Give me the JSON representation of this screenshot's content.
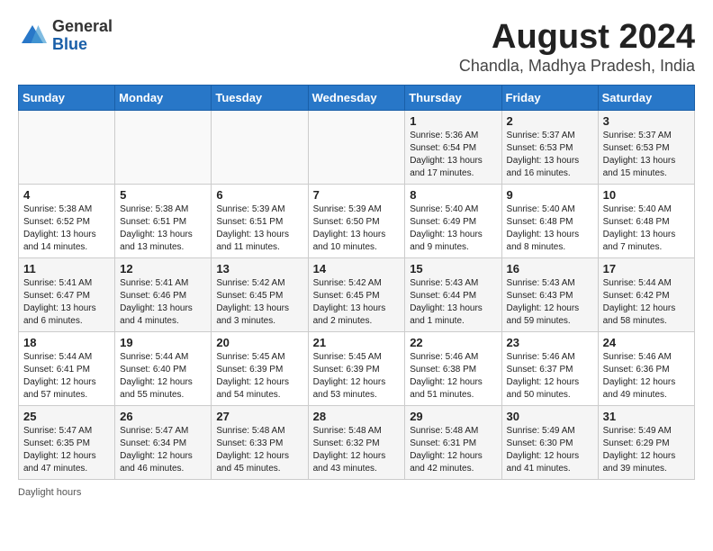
{
  "logo": {
    "line1": "General",
    "line2": "Blue"
  },
  "title": "August 2024",
  "subtitle": "Chandla, Madhya Pradesh, India",
  "days_of_week": [
    "Sunday",
    "Monday",
    "Tuesday",
    "Wednesday",
    "Thursday",
    "Friday",
    "Saturday"
  ],
  "weeks": [
    [
      {
        "day": "",
        "info": ""
      },
      {
        "day": "",
        "info": ""
      },
      {
        "day": "",
        "info": ""
      },
      {
        "day": "",
        "info": ""
      },
      {
        "day": "1",
        "info": "Sunrise: 5:36 AM\nSunset: 6:54 PM\nDaylight: 13 hours and 17 minutes."
      },
      {
        "day": "2",
        "info": "Sunrise: 5:37 AM\nSunset: 6:53 PM\nDaylight: 13 hours and 16 minutes."
      },
      {
        "day": "3",
        "info": "Sunrise: 5:37 AM\nSunset: 6:53 PM\nDaylight: 13 hours and 15 minutes."
      }
    ],
    [
      {
        "day": "4",
        "info": "Sunrise: 5:38 AM\nSunset: 6:52 PM\nDaylight: 13 hours and 14 minutes."
      },
      {
        "day": "5",
        "info": "Sunrise: 5:38 AM\nSunset: 6:51 PM\nDaylight: 13 hours and 13 minutes."
      },
      {
        "day": "6",
        "info": "Sunrise: 5:39 AM\nSunset: 6:51 PM\nDaylight: 13 hours and 11 minutes."
      },
      {
        "day": "7",
        "info": "Sunrise: 5:39 AM\nSunset: 6:50 PM\nDaylight: 13 hours and 10 minutes."
      },
      {
        "day": "8",
        "info": "Sunrise: 5:40 AM\nSunset: 6:49 PM\nDaylight: 13 hours and 9 minutes."
      },
      {
        "day": "9",
        "info": "Sunrise: 5:40 AM\nSunset: 6:48 PM\nDaylight: 13 hours and 8 minutes."
      },
      {
        "day": "10",
        "info": "Sunrise: 5:40 AM\nSunset: 6:48 PM\nDaylight: 13 hours and 7 minutes."
      }
    ],
    [
      {
        "day": "11",
        "info": "Sunrise: 5:41 AM\nSunset: 6:47 PM\nDaylight: 13 hours and 6 minutes."
      },
      {
        "day": "12",
        "info": "Sunrise: 5:41 AM\nSunset: 6:46 PM\nDaylight: 13 hours and 4 minutes."
      },
      {
        "day": "13",
        "info": "Sunrise: 5:42 AM\nSunset: 6:45 PM\nDaylight: 13 hours and 3 minutes."
      },
      {
        "day": "14",
        "info": "Sunrise: 5:42 AM\nSunset: 6:45 PM\nDaylight: 13 hours and 2 minutes."
      },
      {
        "day": "15",
        "info": "Sunrise: 5:43 AM\nSunset: 6:44 PM\nDaylight: 13 hours and 1 minute."
      },
      {
        "day": "16",
        "info": "Sunrise: 5:43 AM\nSunset: 6:43 PM\nDaylight: 12 hours and 59 minutes."
      },
      {
        "day": "17",
        "info": "Sunrise: 5:44 AM\nSunset: 6:42 PM\nDaylight: 12 hours and 58 minutes."
      }
    ],
    [
      {
        "day": "18",
        "info": "Sunrise: 5:44 AM\nSunset: 6:41 PM\nDaylight: 12 hours and 57 minutes."
      },
      {
        "day": "19",
        "info": "Sunrise: 5:44 AM\nSunset: 6:40 PM\nDaylight: 12 hours and 55 minutes."
      },
      {
        "day": "20",
        "info": "Sunrise: 5:45 AM\nSunset: 6:39 PM\nDaylight: 12 hours and 54 minutes."
      },
      {
        "day": "21",
        "info": "Sunrise: 5:45 AM\nSunset: 6:39 PM\nDaylight: 12 hours and 53 minutes."
      },
      {
        "day": "22",
        "info": "Sunrise: 5:46 AM\nSunset: 6:38 PM\nDaylight: 12 hours and 51 minutes."
      },
      {
        "day": "23",
        "info": "Sunrise: 5:46 AM\nSunset: 6:37 PM\nDaylight: 12 hours and 50 minutes."
      },
      {
        "day": "24",
        "info": "Sunrise: 5:46 AM\nSunset: 6:36 PM\nDaylight: 12 hours and 49 minutes."
      }
    ],
    [
      {
        "day": "25",
        "info": "Sunrise: 5:47 AM\nSunset: 6:35 PM\nDaylight: 12 hours and 47 minutes."
      },
      {
        "day": "26",
        "info": "Sunrise: 5:47 AM\nSunset: 6:34 PM\nDaylight: 12 hours and 46 minutes."
      },
      {
        "day": "27",
        "info": "Sunrise: 5:48 AM\nSunset: 6:33 PM\nDaylight: 12 hours and 45 minutes."
      },
      {
        "day": "28",
        "info": "Sunrise: 5:48 AM\nSunset: 6:32 PM\nDaylight: 12 hours and 43 minutes."
      },
      {
        "day": "29",
        "info": "Sunrise: 5:48 AM\nSunset: 6:31 PM\nDaylight: 12 hours and 42 minutes."
      },
      {
        "day": "30",
        "info": "Sunrise: 5:49 AM\nSunset: 6:30 PM\nDaylight: 12 hours and 41 minutes."
      },
      {
        "day": "31",
        "info": "Sunrise: 5:49 AM\nSunset: 6:29 PM\nDaylight: 12 hours and 39 minutes."
      }
    ]
  ],
  "footer": "Daylight hours"
}
